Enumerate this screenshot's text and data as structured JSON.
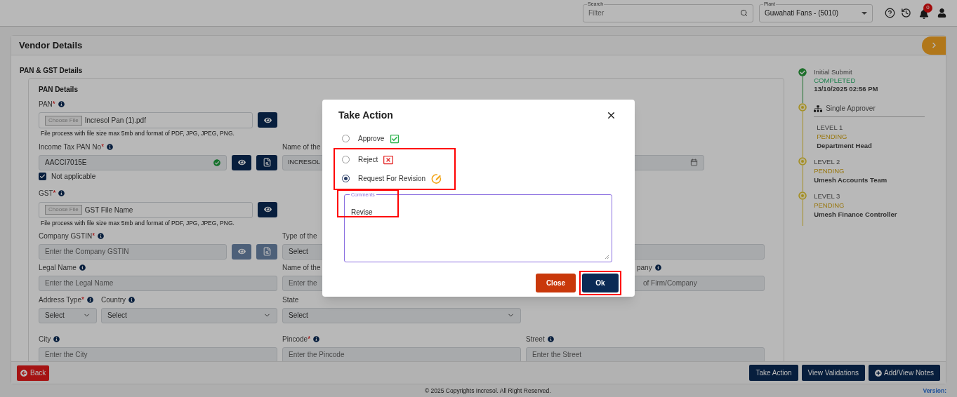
{
  "header": {
    "search": {
      "label": "Search",
      "placeholder": "Filter"
    },
    "plant": {
      "label": "Plant",
      "value": "Guwahati Fans - (5010)"
    },
    "notification_count": "0"
  },
  "page": {
    "title": "Vendor Details",
    "section": "PAN & GST Details",
    "subsection": "PAN Details"
  },
  "form_rows": [
    {
      "cells": [
        {
          "kind": "file",
          "label": "PAN",
          "required_mark": "*",
          "info": true,
          "button": "Choose File",
          "value": "Incresol Pan (1).pdf",
          "note": "File process with file size max 5mb and format of PDF, JPG, JPEG, PNG."
        }
      ]
    },
    {
      "cells": [
        {
          "kind": "text",
          "label": "Income Tax PAN No",
          "required_mark": "*",
          "info": true,
          "value": "AACCI7015E",
          "verified": true,
          "actions": true,
          "actions_disabled": false
        },
        {
          "kind": "text",
          "label": "Name of the",
          "value": "INCRESOL"
        },
        {
          "kind": "date"
        }
      ]
    },
    {
      "cells": [
        {
          "kind": "checkbox",
          "label": "Not applicable",
          "checked": true
        }
      ]
    },
    {
      "cells": [
        {
          "kind": "file",
          "label": "GST",
          "required_mark": "*",
          "info": true,
          "button": "Choose File",
          "value": "GST File Name",
          "note": "File process with file size max 5mb and format of PDF, JPG, JPEG, PNG."
        }
      ]
    },
    {
      "cells": [
        {
          "kind": "text",
          "label": "Company GSTIN",
          "required_mark": "*",
          "info": true,
          "placeholder": "Enter the Company GSTIN",
          "actions": true,
          "actions_disabled": true
        },
        {
          "kind": "select",
          "label": "Type of the",
          "value": "Select"
        },
        {
          "kind": "text"
        }
      ]
    },
    {
      "cells": [
        {
          "kind": "text",
          "label": "Legal Name",
          "info": true,
          "placeholder": "Enter the Legal Name"
        },
        {
          "kind": "text",
          "label": "Name of the",
          "placeholder": "Enter the"
        },
        {
          "kind": "text",
          "label": "pany",
          "info": true,
          "placeholder": "of Firm/Company",
          "covered_start": true
        }
      ]
    },
    {
      "cells": [
        {
          "kind": "pair",
          "items": [
            {
              "label": "Address Type",
              "required_mark": "*",
              "info": true,
              "value": "Select"
            },
            {
              "label": "Country",
              "info": true,
              "value": "Select"
            }
          ]
        },
        {
          "kind": "select",
          "label": "State",
          "value": "Select"
        }
      ]
    },
    {
      "cells": [
        {
          "kind": "text",
          "label": "City",
          "info": true,
          "placeholder": "Enter the City"
        },
        {
          "kind": "text",
          "label": "Pincode",
          "required_mark": "*",
          "info": true,
          "placeholder": "Enter the Pincode"
        },
        {
          "kind": "text",
          "label": "Street",
          "info": true,
          "placeholder": "Enter the Street"
        }
      ]
    }
  ],
  "timeline": {
    "initial": {
      "title": "Initial Submit",
      "status": "COMPLETED",
      "completed": true,
      "detail": "13/10/2025 02:56 PM"
    },
    "approver": "Single Approver",
    "levels": [
      {
        "title": "LEVEL 1",
        "status": "PENDING",
        "completed": false,
        "detail": "Department Head"
      },
      {
        "title": "LEVEL 2",
        "status": "PENDING",
        "completed": false,
        "detail": "Umesh Accounts Team"
      },
      {
        "title": "LEVEL 3",
        "status": "PENDING",
        "completed": false,
        "detail": "Umesh Finance Controller"
      }
    ]
  },
  "footer": {
    "back": "Back",
    "actions": [
      {
        "label": "Take Action",
        "icon": false
      },
      {
        "label": "View Validations",
        "icon": false
      },
      {
        "label": "Add/View Notes",
        "icon": true
      }
    ],
    "copyright": "© 2025 Copyrights Incresol. All Right Reserved.",
    "version": "Version:"
  },
  "modal": {
    "title": "Take Action",
    "options": [
      {
        "label": "Approve",
        "kind": "approve",
        "selected": false,
        "highlighted": false
      },
      {
        "label": "Reject",
        "kind": "reject",
        "selected": false,
        "highlighted": true
      },
      {
        "label": "Request For Revision",
        "kind": "revision",
        "selected": true,
        "highlighted": true
      }
    ],
    "comments": {
      "label": "Comments",
      "value": "Revise",
      "highlighted": true
    },
    "buttons": [
      {
        "label": "Close",
        "kind": "close",
        "highlighted": false
      },
      {
        "label": "Ok",
        "kind": "ok",
        "highlighted": true
      }
    ]
  }
}
